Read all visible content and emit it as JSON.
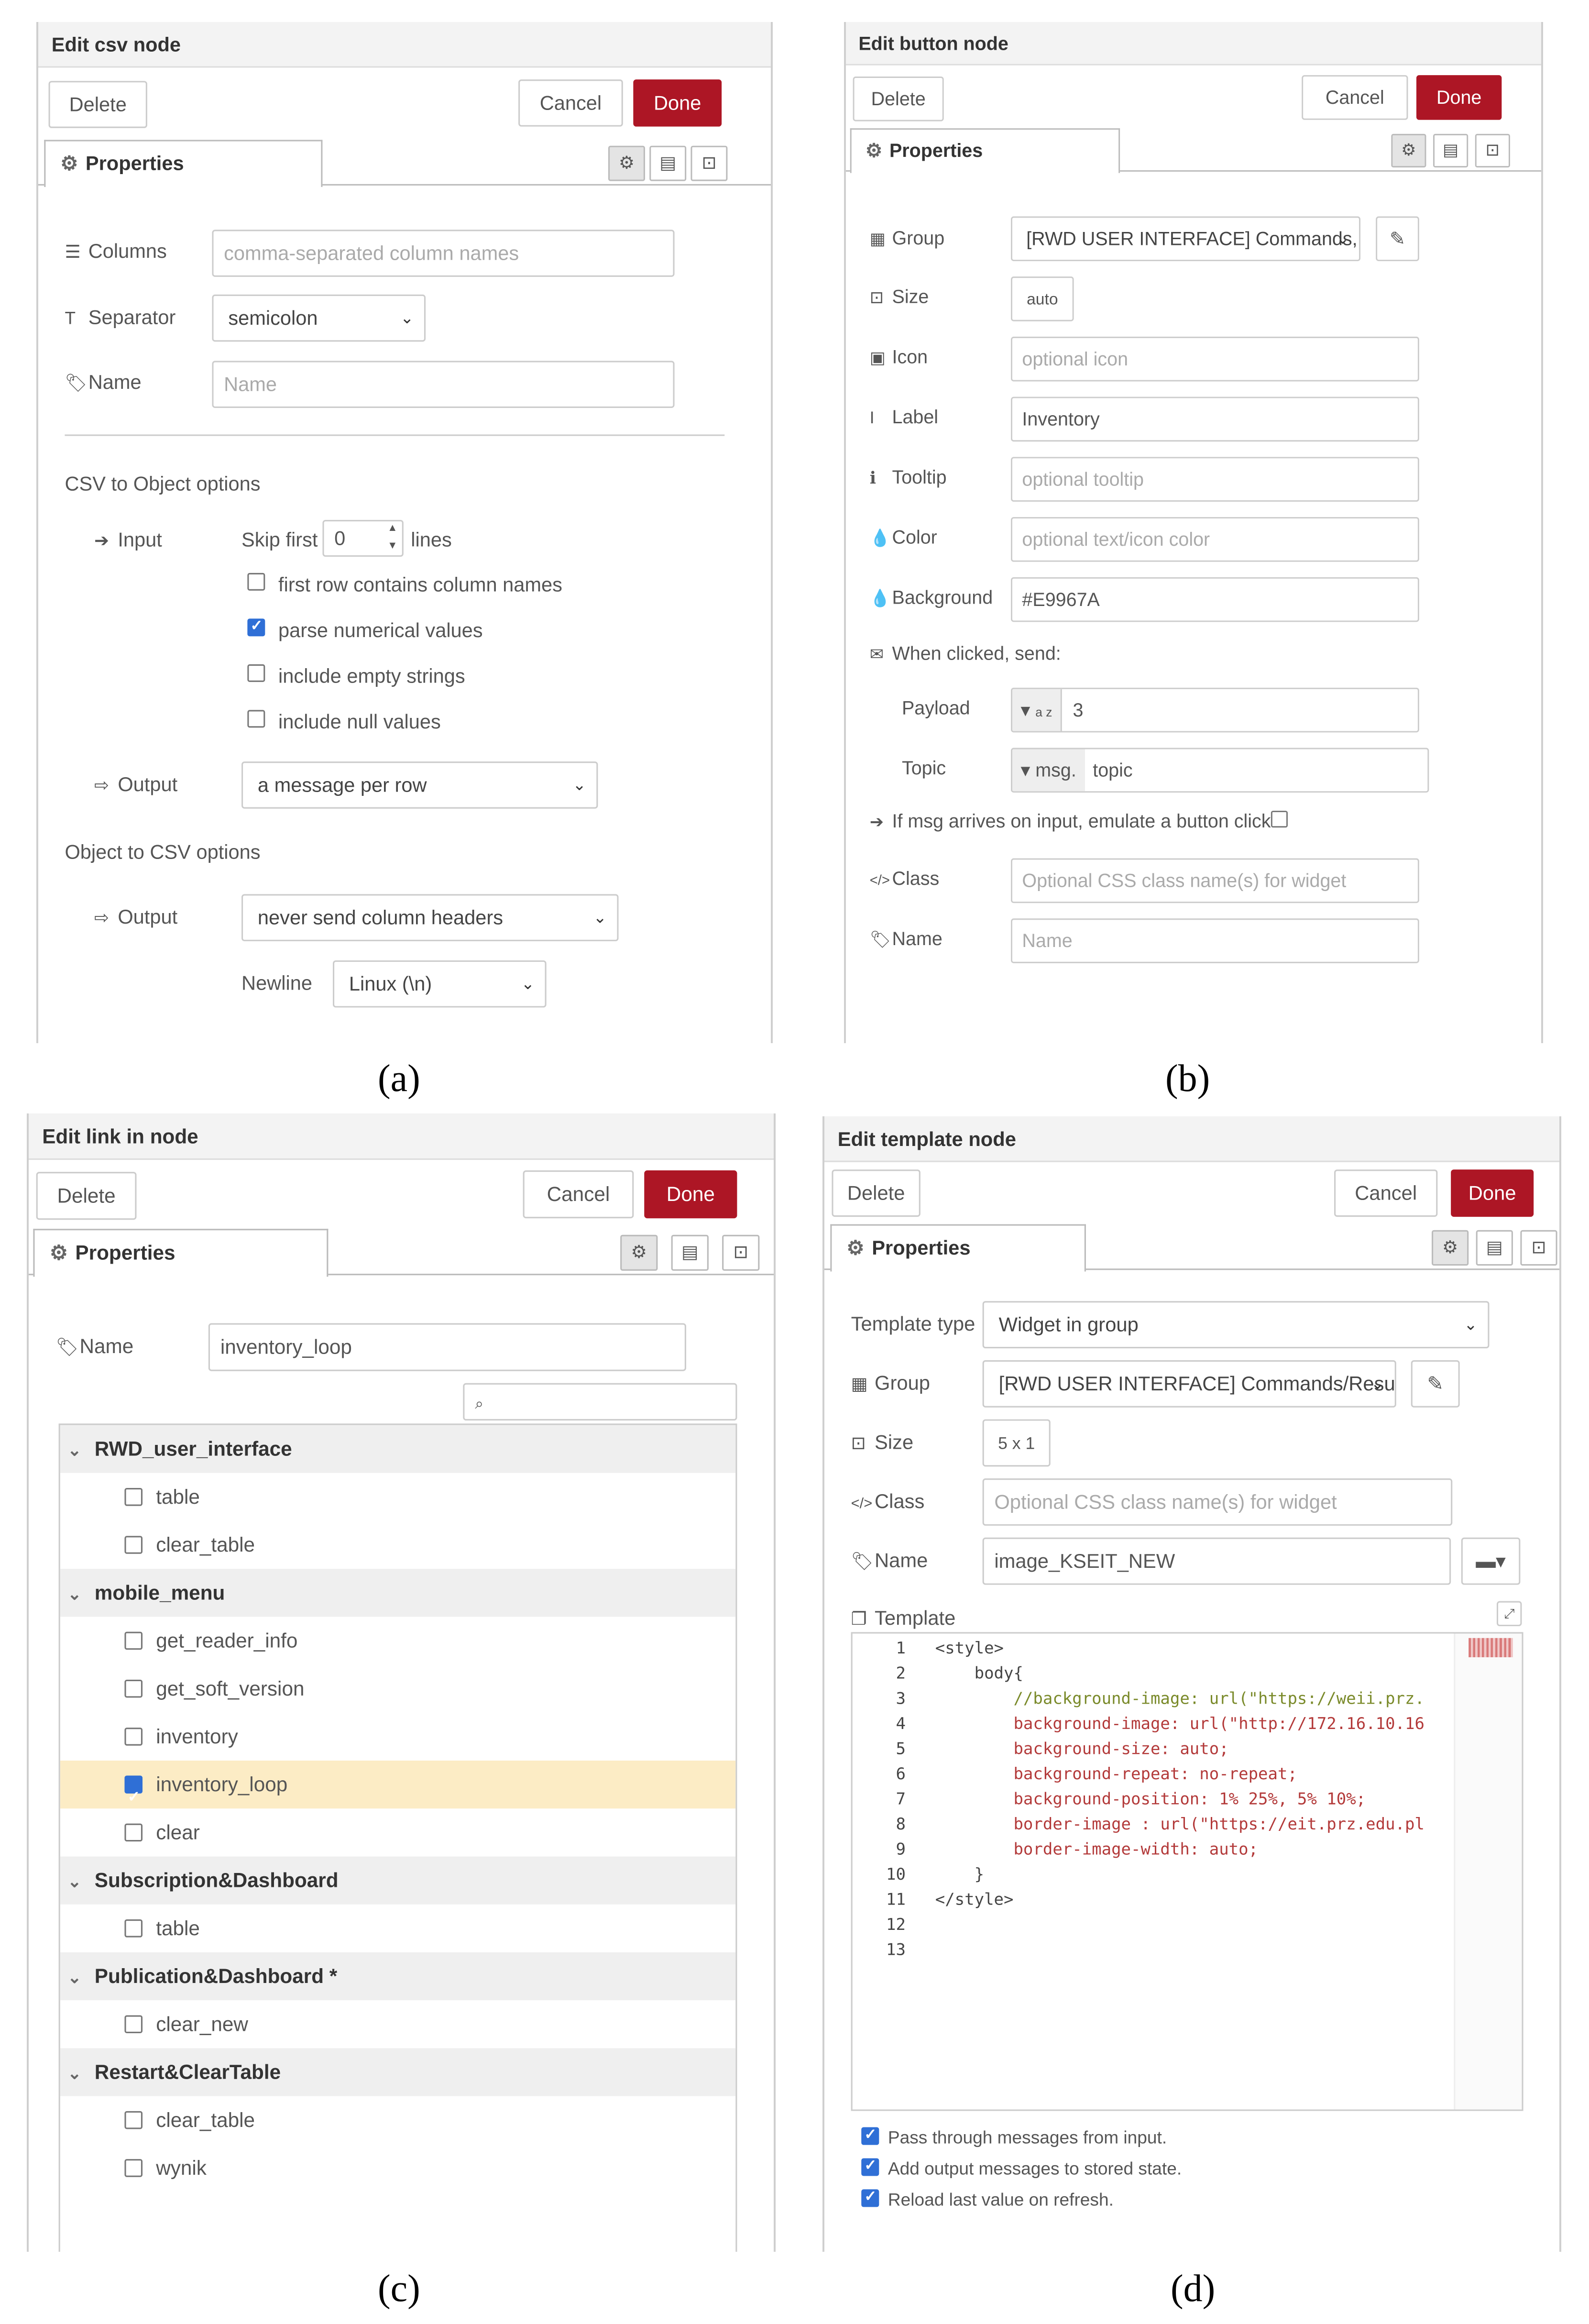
{
  "panel_a": {
    "title": "Edit csv node",
    "delete": "Delete",
    "cancel": "Cancel",
    "done": "Done",
    "tab": "Properties",
    "columns_label": "Columns",
    "columns_placeholder": "comma-separated column names",
    "separator_label": "Separator",
    "separator_value": "semicolon",
    "name_label": "Name",
    "name_placeholder": "Name",
    "csv_to_object": "CSV to Object options",
    "input_label": "Input",
    "skip_first": "Skip first",
    "skip_value": "0",
    "lines": "lines",
    "checks": [
      {
        "label": "first row contains column names",
        "checked": false
      },
      {
        "label": "parse numerical values",
        "checked": true
      },
      {
        "label": "include empty strings",
        "checked": false
      },
      {
        "label": "include null values",
        "checked": false
      }
    ],
    "output_label": "Output",
    "output_value": "a message per row",
    "object_to_csv": "Object to CSV options",
    "output2_label": "Output",
    "output2_value": "never send column headers",
    "newline_label": "Newline",
    "newline_value": "Linux (\\n)",
    "caption": "(a)"
  },
  "panel_b": {
    "title": "Edit button node",
    "delete": "Delete",
    "cancel": "Cancel",
    "done": "Done",
    "tab": "Properties",
    "group_label": "Group",
    "group_value": "[RWD USER INTERFACE] Commands,",
    "size_label": "Size",
    "size_value": "auto",
    "icon_label": "Icon",
    "icon_placeholder": "optional icon",
    "label_label": "Label",
    "label_value": "Inventory",
    "tooltip_label": "Tooltip",
    "tooltip_placeholder": "optional tooltip",
    "color_label": "Color",
    "color_placeholder": "optional text/icon color",
    "background_label": "Background",
    "background_value": "#E9967A",
    "when_clicked": "When clicked, send:",
    "payload_label": "Payload",
    "payload_type": "a z",
    "payload_value": "3",
    "topic_label": "Topic",
    "topic_type": "msg.",
    "topic_value": "topic",
    "emulate": "If msg arrives on input, emulate a button click:",
    "class_label": "Class",
    "class_placeholder": "Optional CSS class name(s) for widget",
    "name_label": "Name",
    "name_placeholder": "Name",
    "caption": "(b)"
  },
  "panel_c": {
    "title": "Edit link in node",
    "delete": "Delete",
    "cancel": "Cancel",
    "done": "Done",
    "tab": "Properties",
    "name_label": "Name",
    "name_value": "inventory_loop",
    "tree": [
      {
        "kind": "group",
        "label": "RWD_user_interface"
      },
      {
        "kind": "item",
        "label": "table",
        "checked": false
      },
      {
        "kind": "item",
        "label": "clear_table",
        "checked": false
      },
      {
        "kind": "group",
        "label": "mobile_menu"
      },
      {
        "kind": "item",
        "label": "get_reader_info",
        "checked": false
      },
      {
        "kind": "item",
        "label": "get_soft_version",
        "checked": false
      },
      {
        "kind": "item",
        "label": "inventory",
        "checked": false
      },
      {
        "kind": "item",
        "label": "inventory_loop",
        "checked": true
      },
      {
        "kind": "item",
        "label": "clear",
        "checked": false
      },
      {
        "kind": "group",
        "label": "Subscription&Dashboard"
      },
      {
        "kind": "item",
        "label": "table",
        "checked": false
      },
      {
        "kind": "group",
        "label": "Publication&Dashboard *"
      },
      {
        "kind": "item",
        "label": "clear_new",
        "checked": false
      },
      {
        "kind": "group",
        "label": "Restart&ClearTable"
      },
      {
        "kind": "item",
        "label": "clear_table",
        "checked": false
      },
      {
        "kind": "item",
        "label": "wynik",
        "checked": false
      }
    ],
    "caption": "(c)"
  },
  "panel_d": {
    "title": "Edit template node",
    "delete": "Delete",
    "cancel": "Cancel",
    "done": "Done",
    "tab": "Properties",
    "template_type_label": "Template type",
    "template_type_value": "Widget in group",
    "group_label": "Group",
    "group_value": "[RWD USER INTERFACE] Commands/Resul",
    "size_label": "Size",
    "size_value": "5 x 1",
    "class_label": "Class",
    "class_placeholder": "Optional CSS class name(s) for widget",
    "name_label": "Name",
    "name_value": "image_KSEIT_NEW",
    "template_label": "Template",
    "code": [
      {
        "n": "1",
        "text": "<style>",
        "color": "#444"
      },
      {
        "n": "2",
        "text": "    body{",
        "color": "#444"
      },
      {
        "n": "3",
        "text": "        //background-image: url(\"https://weii.prz.",
        "color": "#7a8a2a"
      },
      {
        "n": "4",
        "text": "        background-image: url(\"http://172.16.10.16",
        "color": "#b33a3a"
      },
      {
        "n": "5",
        "text": "        background-size: auto;",
        "color": "#b33a3a"
      },
      {
        "n": "6",
        "text": "        background-repeat: no-repeat;",
        "color": "#b33a3a"
      },
      {
        "n": "7",
        "text": "        background-position: 1% 25%, 5% 10%;",
        "color": "#b33a3a"
      },
      {
        "n": "8",
        "text": "        border-image : url(\"https://eit.prz.edu.pl",
        "color": "#b33a3a"
      },
      {
        "n": "9",
        "text": "        border-image-width: auto;",
        "color": "#b33a3a"
      },
      {
        "n": "10",
        "text": "    }",
        "color": "#444"
      },
      {
        "n": "11",
        "text": "</style>",
        "color": "#444"
      },
      {
        "n": "12",
        "text": "",
        "color": "#444"
      },
      {
        "n": "13",
        "text": "",
        "color": "#444"
      }
    ],
    "checks": [
      {
        "label": "Pass through messages from input.",
        "checked": true
      },
      {
        "label": "Add output messages to stored state.",
        "checked": true
      },
      {
        "label": "Reload last value on refresh.",
        "checked": true
      }
    ],
    "caption": "(d)"
  }
}
